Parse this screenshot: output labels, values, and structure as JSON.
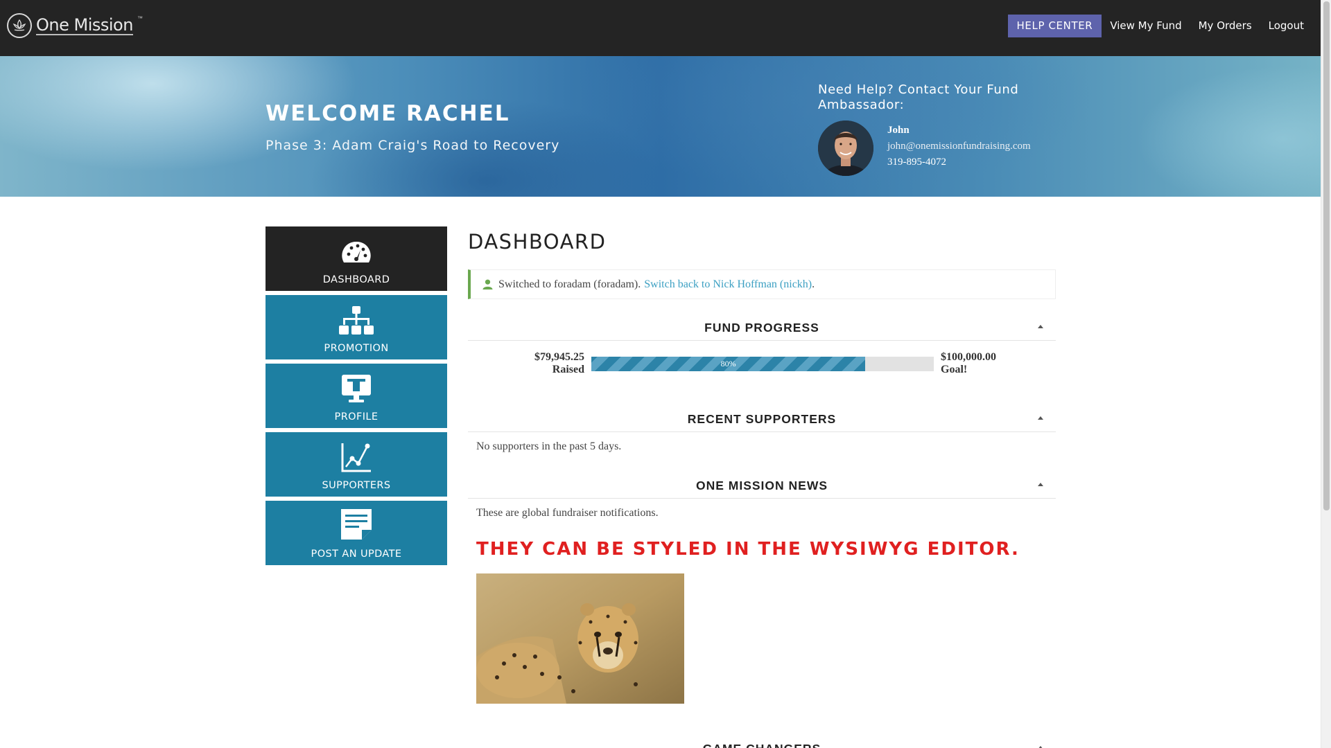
{
  "brand": {
    "name": "One Mission",
    "tm": "™"
  },
  "nav": {
    "help_center": "HELP CENTER",
    "view_fund": "View My Fund",
    "orders": "My Orders",
    "logout": "Logout"
  },
  "banner": {
    "welcome": "WELCOME RACHEL",
    "phase": "Phase 3: Adam Craig's Road to Recovery",
    "help_heading": "Need Help? Contact Your Fund Ambassador:",
    "ambassador": {
      "name": "John",
      "email": "john@onemissionfundraising.com",
      "phone": "319-895-4072"
    }
  },
  "sidebar": {
    "items": [
      {
        "label": "DASHBOARD",
        "icon": "speedometer-icon",
        "active": true
      },
      {
        "label": "PROMOTION",
        "icon": "sitemap-icon",
        "active": false
      },
      {
        "label": "PROFILE",
        "icon": "monitor-icon",
        "active": false
      },
      {
        "label": "SUPPORTERS",
        "icon": "line-chart-icon",
        "active": false
      },
      {
        "label": "POST AN UPDATE",
        "icon": "note-icon",
        "active": false
      }
    ]
  },
  "main": {
    "title": "DASHBOARD",
    "notice": {
      "text": "Switched to foradam (foradam).",
      "link": "Switch back to Nick Hoffman (nickh)",
      "suffix": "."
    },
    "fund_progress": {
      "heading": "FUND PROGRESS",
      "raised_amount": "$79,945.25",
      "raised_label": "Raised",
      "goal_amount": "$100,000.00",
      "goal_label": "Goal!",
      "percent": 80,
      "percent_text": "80%"
    },
    "recent_supporters": {
      "heading": "RECENT SUPPORTERS",
      "empty_text": "No supporters in the past 5 days."
    },
    "news": {
      "heading": "ONE MISSION NEWS",
      "intro": "These are global fundraiser notifications.",
      "styled_text": "THEY CAN BE STYLED IN THE WYSIWYG EDITOR."
    },
    "game_changers": {
      "heading": "GAME CHANGERS"
    }
  },
  "colors": {
    "topbar": "#242424",
    "help_button": "#5e63ac",
    "sidebar_item": "#1d7fa2",
    "sidebar_active": "#232323",
    "link": "#3b9fc2",
    "news_red": "#e02020",
    "notice_border": "#6aa84f"
  }
}
